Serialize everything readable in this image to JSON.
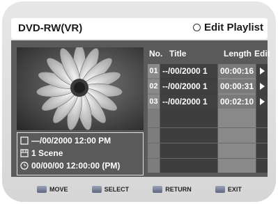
{
  "header": {
    "device_label": "DVD-RW(VR)",
    "screen_title": "Edit Playlist",
    "title_icon": "circle-icon"
  },
  "info": {
    "date": "—/00/2000 12:00 PM",
    "scenes": "1 Scene",
    "time": "00/00/00 12:00:00 (PM)",
    "icons": [
      "date-icon",
      "scene-icon",
      "clock-icon"
    ]
  },
  "table": {
    "headers": {
      "no": "No.",
      "title": "Title",
      "length": "Length",
      "edit": "Edit"
    },
    "rows": [
      {
        "no": "01",
        "title": "--/00/2000 1",
        "length": "00:00:16",
        "selected": true
      },
      {
        "no": "02",
        "title": "--/00/2000 1",
        "length": "00:00:31",
        "selected": false
      },
      {
        "no": "03",
        "title": "--/00/2000 1",
        "length": "00:02:10",
        "selected": false
      }
    ]
  },
  "footer": {
    "move": "MOVE",
    "select": "SELECT",
    "return": "RETURN",
    "exit": "EXIT"
  },
  "colors": {
    "panel": "#5a5a5a",
    "length_column": "#898989",
    "highlight": "#8a8a8a"
  }
}
